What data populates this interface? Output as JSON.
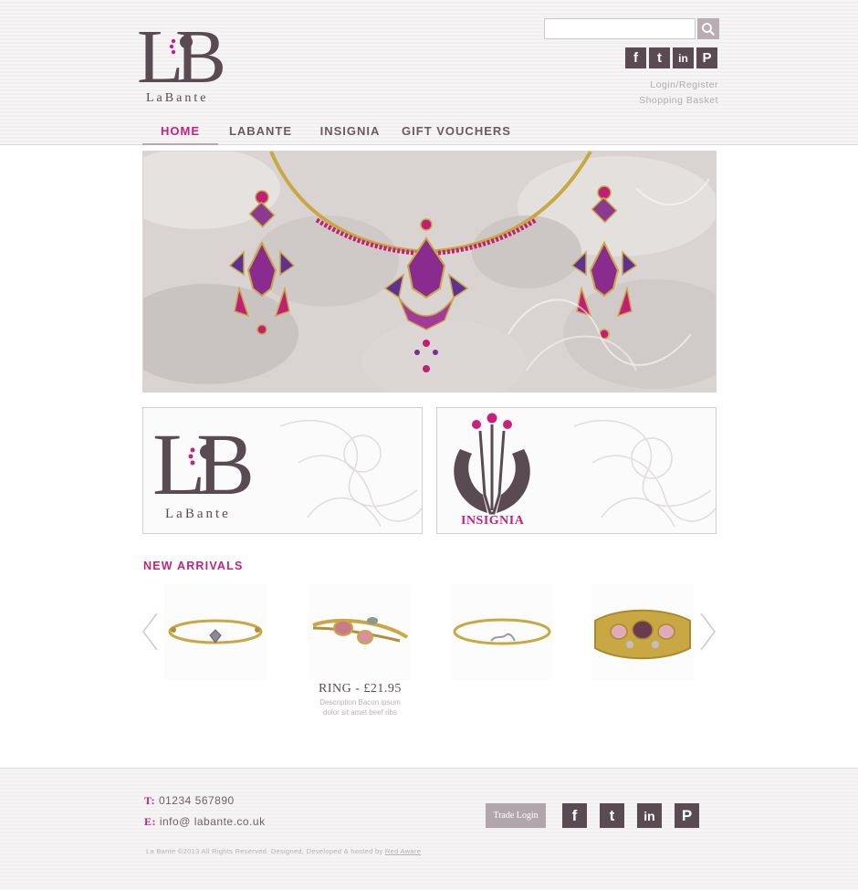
{
  "brand": {
    "name": "LaBante",
    "insignia_label": "INSIGNIA"
  },
  "search": {
    "placeholder": "",
    "value": ""
  },
  "social": [
    "facebook-icon",
    "twitter-icon",
    "linkedin-icon",
    "pinterest-icon"
  ],
  "account": {
    "login": "Login/Register",
    "basket": "Shopping Basket"
  },
  "nav": {
    "items": [
      {
        "label": "HOME",
        "active": true
      },
      {
        "label": "LABANTE",
        "active": false
      },
      {
        "label": "INSIGNIA",
        "active": false
      },
      {
        "label": "GIFT VOUCHERS",
        "active": false
      }
    ]
  },
  "new_arrivals": {
    "title": "NEW ARRIVALS",
    "featured": {
      "name": "RING - £21.95",
      "description_line1": "Description Bacon ipsum",
      "description_line2": "dolor sit amet beef ribs"
    }
  },
  "footer": {
    "phone_label": "T:",
    "phone": "01234 567890",
    "email_label": "E:",
    "email": "info@ labante.co.uk",
    "trade_login": "Trade Login",
    "copyright": "La Bante ©2013 All Rights Reserved. Designed, Developed & hosted by ",
    "copyright_link": "Red Aware"
  },
  "colors": {
    "accent": "#c8207f",
    "brand_dark": "#5a4a52",
    "muted": "#b1a6ab"
  }
}
